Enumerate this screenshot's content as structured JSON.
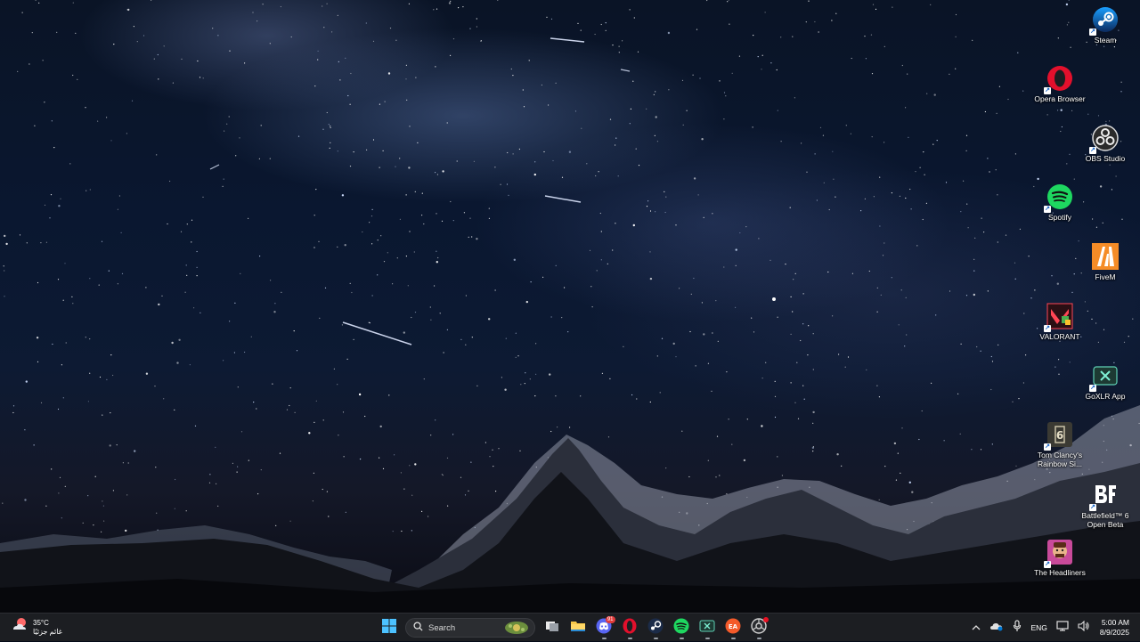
{
  "desktop_icons": [
    {
      "label": "Steam",
      "icon": "steam-icon"
    },
    {
      "label": "Opera Browser",
      "icon": "opera-icon"
    },
    {
      "label": "OBS Studio",
      "icon": "obs-icon"
    },
    {
      "label": "Spotify",
      "icon": "spotify-icon"
    },
    {
      "label": "FiveM",
      "icon": "fivem-icon"
    },
    {
      "label": "VALORANT",
      "icon": "valorant-icon"
    },
    {
      "label": "GoXLR App",
      "icon": "goxlr-icon"
    },
    {
      "label": "Tom Clancy's Rainbow Si...",
      "icon": "rainbow-six-icon"
    },
    {
      "label": "Battlefield™ 6 Open Beta",
      "icon": "battlefield-icon"
    },
    {
      "label": "The Headliners",
      "icon": "headliners-icon"
    }
  ],
  "taskbar": {
    "weather": {
      "temp": "35°C",
      "desc": "غائم جزئيًا"
    },
    "search_placeholder": "Search",
    "discord_badge": "91",
    "pinned": [
      "start-icon",
      "search-box",
      "task-view-icon",
      "file-explorer-icon",
      "discord-icon",
      "opera-icon",
      "steam-icon",
      "spotify-icon",
      "goxlr-icon",
      "ea-icon",
      "chrome-icon"
    ],
    "tray": {
      "language": "ENG",
      "time": "5:00 AM",
      "date": "8/9/2025"
    }
  },
  "colors": {
    "taskbar_bg": "#1c1e22",
    "accent": "#0078d4"
  }
}
